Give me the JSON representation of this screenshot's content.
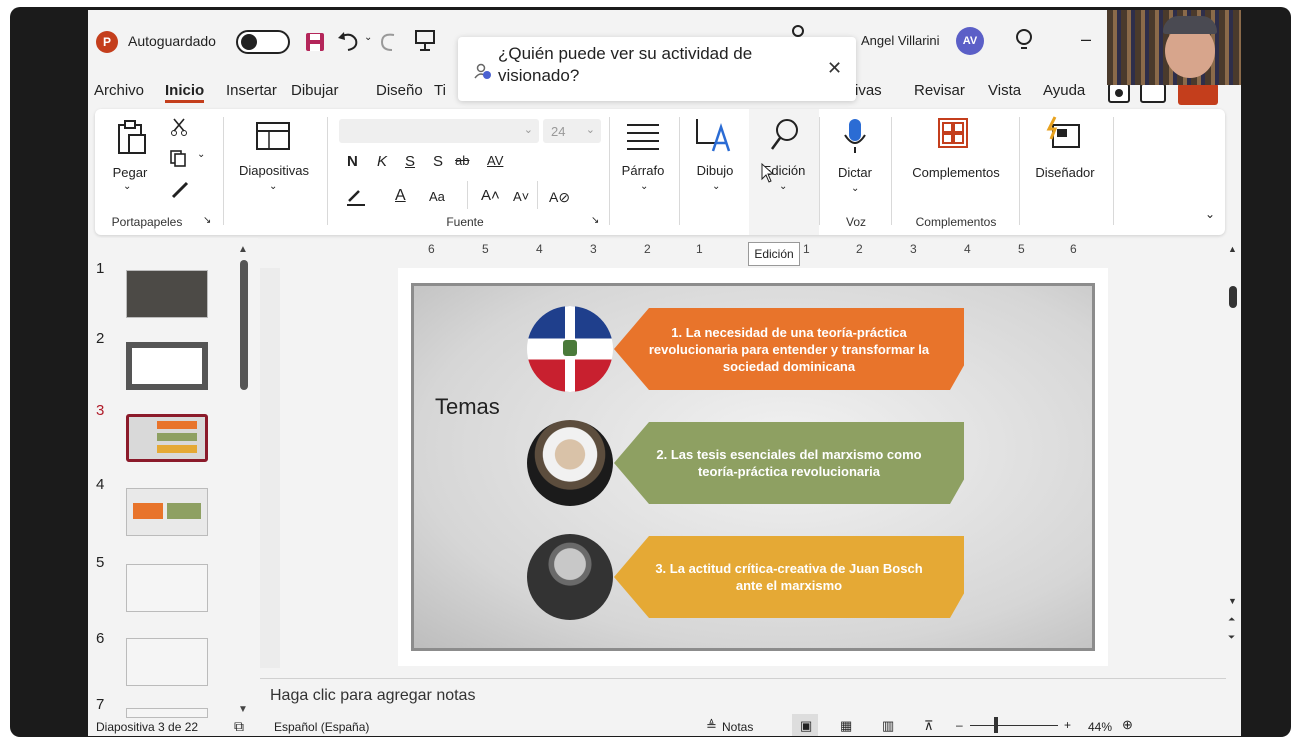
{
  "app": {
    "autosave_label": "Autoguardado",
    "user_name": "Angel Villarini",
    "user_initials": "AV",
    "logo_letter": "P"
  },
  "popup": {
    "text": "¿Quién puede ver su actividad de visionado?",
    "close": "✕"
  },
  "menu": [
    "Archivo",
    "Inicio",
    "Insertar",
    "Dibujar",
    "Diseño",
    "Ti",
    "ivas",
    "Revisar",
    "Vista",
    "Ayuda"
  ],
  "ribbon": {
    "pegar": "Pegar",
    "portapapeles": "Portapapeles",
    "diapositivas": "Diapositivas",
    "font_size": "24",
    "bold": "N",
    "italic": "K",
    "underline": "S",
    "strike": "S",
    "fuente": "Fuente",
    "parrafo": "Párrafo",
    "dibujo": "Dibujo",
    "edicion": "Edición",
    "dictar": "Dictar",
    "voz": "Voz",
    "complementos": "Complementos",
    "complementos_group": "Complementos",
    "disenador": "Diseñador",
    "tooltip": "Edición"
  },
  "ruler": [
    "6",
    "5",
    "4",
    "3",
    "2",
    "1",
    "1",
    "2",
    "3",
    "4",
    "5",
    "6"
  ],
  "thumbnails": [
    "1",
    "2",
    "3",
    "4",
    "5",
    "6",
    "7"
  ],
  "slide": {
    "title": "Temas",
    "items": [
      "1. La necesidad de una teoría-práctica revolucionaria para entender y transformar la sociedad dominicana",
      "2. Las tesis esenciales del marxismo como teoría-práctica revolucionaria",
      "3. La actitud crítica-creativa de Juan Bosch ante el marxismo"
    ],
    "colors": [
      "#e8742b",
      "#8ea062",
      "#e5a935"
    ]
  },
  "notes_placeholder": "Haga clic para agregar notas",
  "status": {
    "slide_info": "Diapositiva 3 de 22",
    "language": "Español (España)",
    "notes": "Notas",
    "zoom": "44%"
  }
}
